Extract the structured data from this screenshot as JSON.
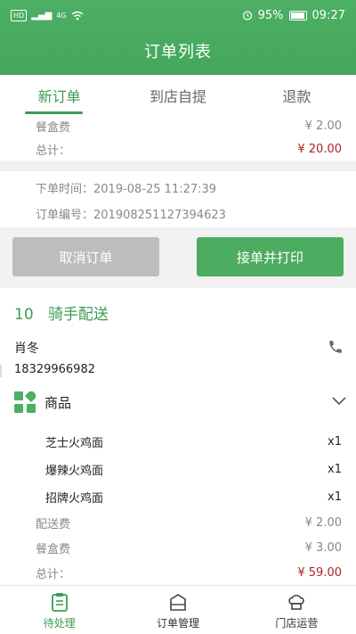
{
  "status": {
    "battery": "95%",
    "time": "09:27",
    "net_tag": "HD",
    "signal": "4G"
  },
  "header": {
    "title": "订单列表"
  },
  "tabs": [
    {
      "label": "新订单",
      "active": true
    },
    {
      "label": "到店自提",
      "active": false
    },
    {
      "label": "退款",
      "active": false
    }
  ],
  "prev_order": {
    "box_fee_label": "餐盒费",
    "box_fee": "¥ 2.00",
    "total_label": "总计：",
    "total": "¥ 20.00",
    "order_time": "下单时间：2019-08-25 11:27:39",
    "order_no": "订单编号：201908251127394623"
  },
  "actions": {
    "cancel_label": "取消订单",
    "accept_label": "接单并打印"
  },
  "order": {
    "number": "10",
    "delivery_type": "骑手配送",
    "customer_name": "肖冬",
    "customer_phone": "18329966982",
    "goods_label": "商品",
    "items": [
      {
        "name": "芝士火鸡面",
        "qty": "x1"
      },
      {
        "name": "爆辣火鸡面",
        "qty": "x1"
      },
      {
        "name": "招牌火鸡面",
        "qty": "x1"
      }
    ],
    "delivery_fee_label": "配送费",
    "delivery_fee": "¥ 2.00",
    "box_fee_label": "餐盒费",
    "box_fee": "¥ 3.00",
    "total_label": "总计：",
    "total": "¥ 59.00"
  },
  "bottom_nav": [
    {
      "label": "待处理",
      "icon": "clipboard-icon",
      "active": true
    },
    {
      "label": "订单管理",
      "icon": "order-manage-icon",
      "active": false
    },
    {
      "label": "门店运营",
      "icon": "chef-hat-icon",
      "active": false
    }
  ],
  "colors": {
    "brand": "#4caf63",
    "accent_text": "#3d9c52",
    "price_red": "#b0202a"
  }
}
